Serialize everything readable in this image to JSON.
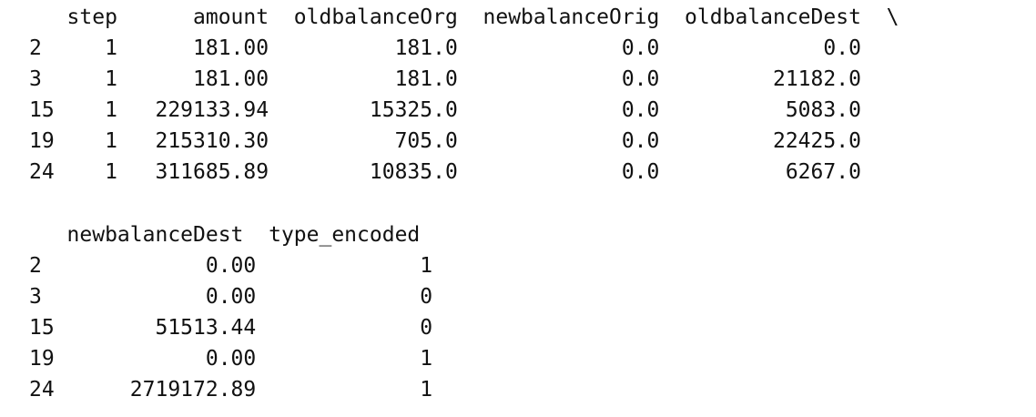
{
  "blocks": [
    {
      "header": "   step      amount  oldbalanceOrg  newbalanceOrig  oldbalanceDest  \\",
      "rows": [
        "2     1      181.00          181.0             0.0             0.0",
        "3     1      181.00          181.0             0.0         21182.0",
        "15    1   229133.94        15325.0             0.0          5083.0",
        "19    1   215310.30          705.0             0.0         22425.0",
        "24    1   311685.89        10835.0             0.0          6267.0"
      ]
    },
    {
      "header": "   newbalanceDest  type_encoded",
      "rows": [
        "2             0.00             1",
        "3             0.00             0",
        "15        51513.44             0",
        "19            0.00             1",
        "24      2719172.89             1"
      ]
    }
  ]
}
